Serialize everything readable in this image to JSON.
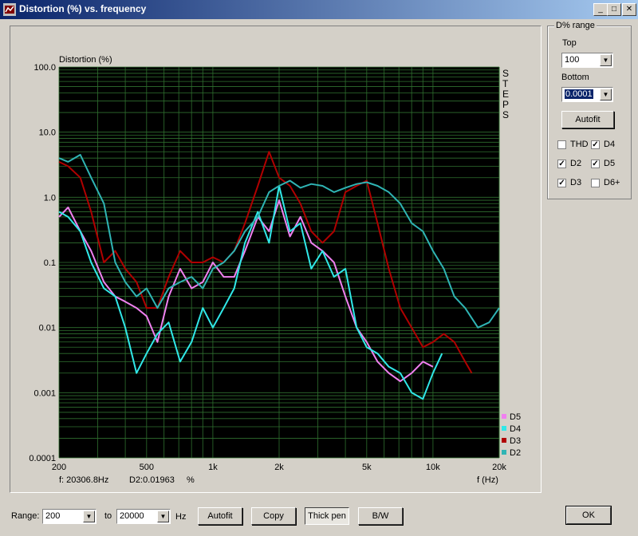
{
  "window": {
    "title": "Distortion (%) vs. frequency",
    "min": "_",
    "max": "□",
    "close": "✕"
  },
  "range_panel": {
    "title": "D% range",
    "top_label": "Top",
    "top_value": "100",
    "bottom_label": "Bottom",
    "bottom_value": "0.0001",
    "autofit": "Autofit",
    "checks": [
      {
        "label": "THD",
        "checked": false
      },
      {
        "label": "D4",
        "checked": true
      },
      {
        "label": "D2",
        "checked": true
      },
      {
        "label": "D5",
        "checked": true
      },
      {
        "label": "D3",
        "checked": true
      },
      {
        "label": "D6+",
        "checked": false
      }
    ]
  },
  "bottom_bar": {
    "range_label": "Range:",
    "from": "200",
    "to_label": "to",
    "to": "20000",
    "unit": "Hz",
    "autofit": "Autofit",
    "copy": "Copy",
    "thick_pen": "Thick pen",
    "bw": "B/W",
    "ok": "OK"
  },
  "readout": {
    "freq": "f: 20306.8Hz",
    "value": "D2:0.01963",
    "unit": "%"
  },
  "steps_label": "STEPS",
  "colors": {
    "D2": "#2fb4b4",
    "D3": "#b00000",
    "D4": "#30e8e8",
    "D5": "#f080f0",
    "grid": "#2f6f2f",
    "plot_bg": "#000000"
  },
  "chart_data": {
    "type": "line",
    "ylabel": "Distortion (%)",
    "xlabel": "f (Hz)",
    "xscale": "log",
    "yscale": "log",
    "xlim": [
      200,
      20000
    ],
    "ylim": [
      0.0001,
      100
    ],
    "xticks": [
      {
        "v": 200,
        "t": "200"
      },
      {
        "v": 500,
        "t": "500"
      },
      {
        "v": 1000,
        "t": "1k"
      },
      {
        "v": 2000,
        "t": "2k"
      },
      {
        "v": 5000,
        "t": "5k"
      },
      {
        "v": 10000,
        "t": "10k"
      },
      {
        "v": 20000,
        "t": "20k"
      }
    ],
    "yticks": [
      {
        "v": 100,
        "t": "100.0"
      },
      {
        "v": 10,
        "t": "10.0"
      },
      {
        "v": 1,
        "t": "1.0"
      },
      {
        "v": 0.1,
        "t": "0.1"
      },
      {
        "v": 0.01,
        "t": "0.01"
      },
      {
        "v": 0.001,
        "t": "0.001"
      },
      {
        "v": 0.0001,
        "t": "0.0001"
      }
    ],
    "legend": "bottom-right",
    "grid": true,
    "series": [
      {
        "name": "D5",
        "x": [
          200,
          220,
          250,
          280,
          320,
          360,
          400,
          450,
          500,
          560,
          630,
          710,
          800,
          900,
          1000,
          1120,
          1250,
          1400,
          1600,
          1800,
          2000,
          2240,
          2500,
          2800,
          3150,
          3550,
          4000,
          4500,
          5000,
          5600,
          6300,
          7100,
          8000,
          9000,
          10000
        ],
        "y": [
          0.5,
          0.7,
          0.3,
          0.15,
          0.05,
          0.03,
          0.025,
          0.02,
          0.015,
          0.006,
          0.03,
          0.08,
          0.04,
          0.05,
          0.1,
          0.06,
          0.06,
          0.15,
          0.5,
          0.3,
          0.9,
          0.25,
          0.5,
          0.2,
          0.15,
          0.1,
          0.03,
          0.01,
          0.006,
          0.003,
          0.002,
          0.0015,
          0.002,
          0.003,
          0.0025
        ]
      },
      {
        "name": "D4",
        "x": [
          200,
          220,
          250,
          280,
          320,
          360,
          400,
          450,
          500,
          560,
          630,
          710,
          800,
          900,
          1000,
          1120,
          1250,
          1400,
          1600,
          1800,
          2000,
          2240,
          2500,
          2800,
          3150,
          3550,
          4000,
          4500,
          5000,
          5600,
          6300,
          7100,
          8000,
          9000,
          10000,
          11000
        ],
        "y": [
          0.6,
          0.5,
          0.3,
          0.1,
          0.04,
          0.03,
          0.01,
          0.002,
          0.004,
          0.008,
          0.012,
          0.003,
          0.006,
          0.02,
          0.01,
          0.02,
          0.04,
          0.2,
          0.6,
          0.2,
          1.5,
          0.3,
          0.4,
          0.08,
          0.15,
          0.06,
          0.08,
          0.01,
          0.005,
          0.004,
          0.0025,
          0.002,
          0.001,
          0.0008,
          0.002,
          0.004
        ]
      },
      {
        "name": "D3",
        "x": [
          200,
          220,
          250,
          280,
          320,
          360,
          400,
          450,
          500,
          560,
          630,
          710,
          800,
          900,
          1000,
          1120,
          1250,
          1400,
          1600,
          1800,
          2000,
          2240,
          2500,
          2800,
          3150,
          3550,
          4000,
          4500,
          5000,
          5600,
          6300,
          7100,
          8000,
          9000,
          10000,
          11200,
          12500,
          14000,
          15000
        ],
        "y": [
          3.5,
          3,
          2,
          0.6,
          0.1,
          0.15,
          0.08,
          0.05,
          0.02,
          0.02,
          0.06,
          0.15,
          0.1,
          0.1,
          0.12,
          0.1,
          0.15,
          0.4,
          1.5,
          5,
          2,
          1.5,
          0.8,
          0.3,
          0.2,
          0.3,
          1.2,
          1.5,
          1.8,
          0.4,
          0.08,
          0.02,
          0.01,
          0.005,
          0.006,
          0.008,
          0.006,
          0.003,
          0.002
        ]
      },
      {
        "name": "D2",
        "x": [
          200,
          220,
          250,
          280,
          320,
          360,
          400,
          450,
          500,
          560,
          630,
          710,
          800,
          900,
          1000,
          1120,
          1250,
          1400,
          1600,
          1800,
          2000,
          2240,
          2500,
          2800,
          3150,
          3550,
          4000,
          4500,
          5000,
          5600,
          6300,
          7100,
          8000,
          9000,
          10000,
          11200,
          12500,
          14000,
          16000,
          18000,
          20000
        ],
        "y": [
          4,
          3.5,
          4.5,
          2,
          0.8,
          0.1,
          0.05,
          0.03,
          0.04,
          0.02,
          0.04,
          0.05,
          0.06,
          0.04,
          0.08,
          0.1,
          0.15,
          0.3,
          0.5,
          1.2,
          1.5,
          1.8,
          1.4,
          1.6,
          1.5,
          1.2,
          1.4,
          1.6,
          1.7,
          1.5,
          1.2,
          0.8,
          0.4,
          0.3,
          0.15,
          0.08,
          0.03,
          0.02,
          0.01,
          0.012,
          0.02
        ]
      }
    ]
  }
}
